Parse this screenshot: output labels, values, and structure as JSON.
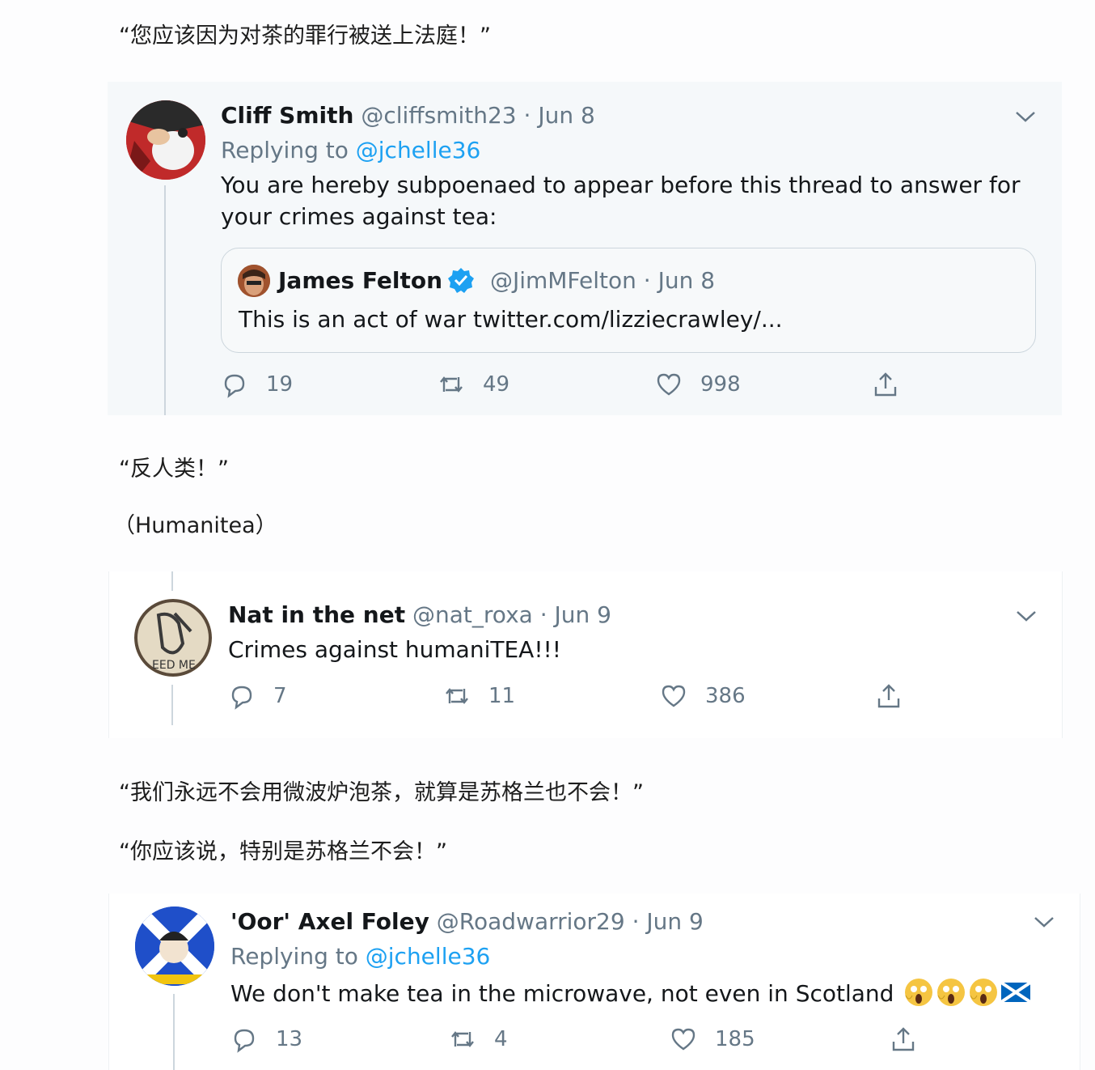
{
  "captions": {
    "c1": "“您应该因为对茶的罪行被送上法庭！”",
    "c2": "“反人类！”",
    "c3": "（Humanitea）",
    "c4": "“我们永远不会用微波炉泡茶，就算是苏格兰也不会！”",
    "c5": "“你应该说，特别是苏格兰不会！”"
  },
  "tweet1": {
    "name": "Cliff Smith",
    "handle": "@cliffsmith23",
    "sep": "·",
    "date": "Jun 8",
    "replying_prefix": "Replying to",
    "replying_to": "@jchelle36",
    "text": "You are hereby subpoenaed to appear before this thread to answer for your crimes against tea:",
    "quote": {
      "name": "James Felton",
      "handle": "@JimMFelton",
      "sep": "·",
      "date": "Jun 8",
      "text": "This is an act of war twitter.com/lizziecrawley/..."
    },
    "replies": "19",
    "retweets": "49",
    "likes": "998"
  },
  "tweet2": {
    "name": "Nat in the net",
    "handle": "@nat_roxa",
    "sep": "·",
    "date": "Jun 9",
    "text": "Crimes against humaniTEA!!!",
    "replies": "7",
    "retweets": "11",
    "likes": "386",
    "avatar_text": "EED ME"
  },
  "tweet3": {
    "name": "'Oor' Axel Foley",
    "handle": "@Roadwarrior29",
    "sep": "·",
    "date": "Jun 9",
    "replying_prefix": "Replying to",
    "replying_to": "@jchelle36",
    "text": "We don't make tea in the microwave, not even in Scotland",
    "emojis": [
      "screaming-face",
      "screaming-face",
      "screaming-face",
      "scotland-flag"
    ],
    "replies": "13",
    "retweets": "4",
    "likes": "185"
  },
  "colors": {
    "link": "#1da1f2",
    "muted": "#657786",
    "card_bg": "#f5f8fa",
    "verified": "#1da1f2"
  }
}
